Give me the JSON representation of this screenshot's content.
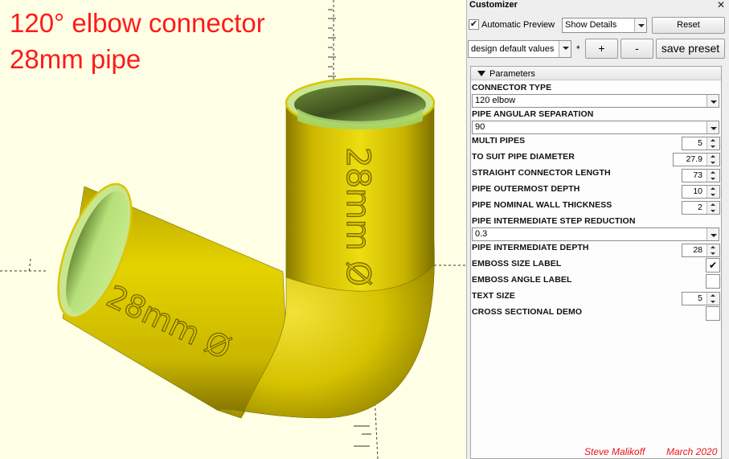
{
  "viewport": {
    "title_line1": "120° elbow connector",
    "title_line2": "28mm pipe",
    "emboss_text_vertical": "28mm Ø",
    "emboss_text_angled": "28mm Ø",
    "credit_author": "Steve Malikoff",
    "credit_date": "March 2020",
    "colors": {
      "background": "#ffffe5",
      "model": "#e6d200",
      "model_shadow": "#8a7a00",
      "inner": "#a6d46a",
      "title": "#ff1a1a"
    }
  },
  "customizer": {
    "title": "Customizer",
    "close_glyph": "✕",
    "automatic_preview_label": "Automatic Preview",
    "automatic_preview_checked": true,
    "show_details_value": "Show Details",
    "reset_label": "Reset",
    "preset_value": "design default values",
    "preset_modified_marker": "*",
    "add_preset_label": "+",
    "remove_preset_label": "-",
    "save_preset_label": "save preset",
    "parameters_header": "Parameters",
    "params": {
      "connector_type": {
        "label": "CONNECTOR TYPE",
        "value": "120 elbow"
      },
      "pipe_angular_separation": {
        "label": "PIPE ANGULAR SEPARATION",
        "value": "90"
      },
      "multi_pipes": {
        "label": "MULTI PIPES",
        "value": "5"
      },
      "to_suit_pipe_diameter": {
        "label": "TO SUIT PIPE DIAMETER",
        "value": "27.9"
      },
      "straight_connector_length": {
        "label": "STRAIGHT CONNECTOR LENGTH",
        "value": "73"
      },
      "pipe_outermost_depth": {
        "label": "PIPE OUTERMOST DEPTH",
        "value": "10"
      },
      "pipe_nominal_wall_thickness": {
        "label": "PIPE NOMINAL WALL THICKNESS",
        "value": "2"
      },
      "pipe_intermediate_step_reduction": {
        "label": "PIPE INTERMEDIATE STEP REDUCTION",
        "value": "0.3"
      },
      "pipe_intermediate_depth": {
        "label": "PIPE INTERMEDIATE DEPTH",
        "value": "28"
      },
      "emboss_size_label": {
        "label": "EMBOSS SIZE LABEL",
        "checked": true,
        "check_glyph": "✔"
      },
      "emboss_angle_label": {
        "label": "EMBOSS ANGLE LABEL",
        "checked": false
      },
      "text_size": {
        "label": "TEXT SIZE",
        "value": "5"
      },
      "cross_sectional_demo": {
        "label": "CROSS SECTIONAL DEMO",
        "checked": false
      }
    }
  }
}
